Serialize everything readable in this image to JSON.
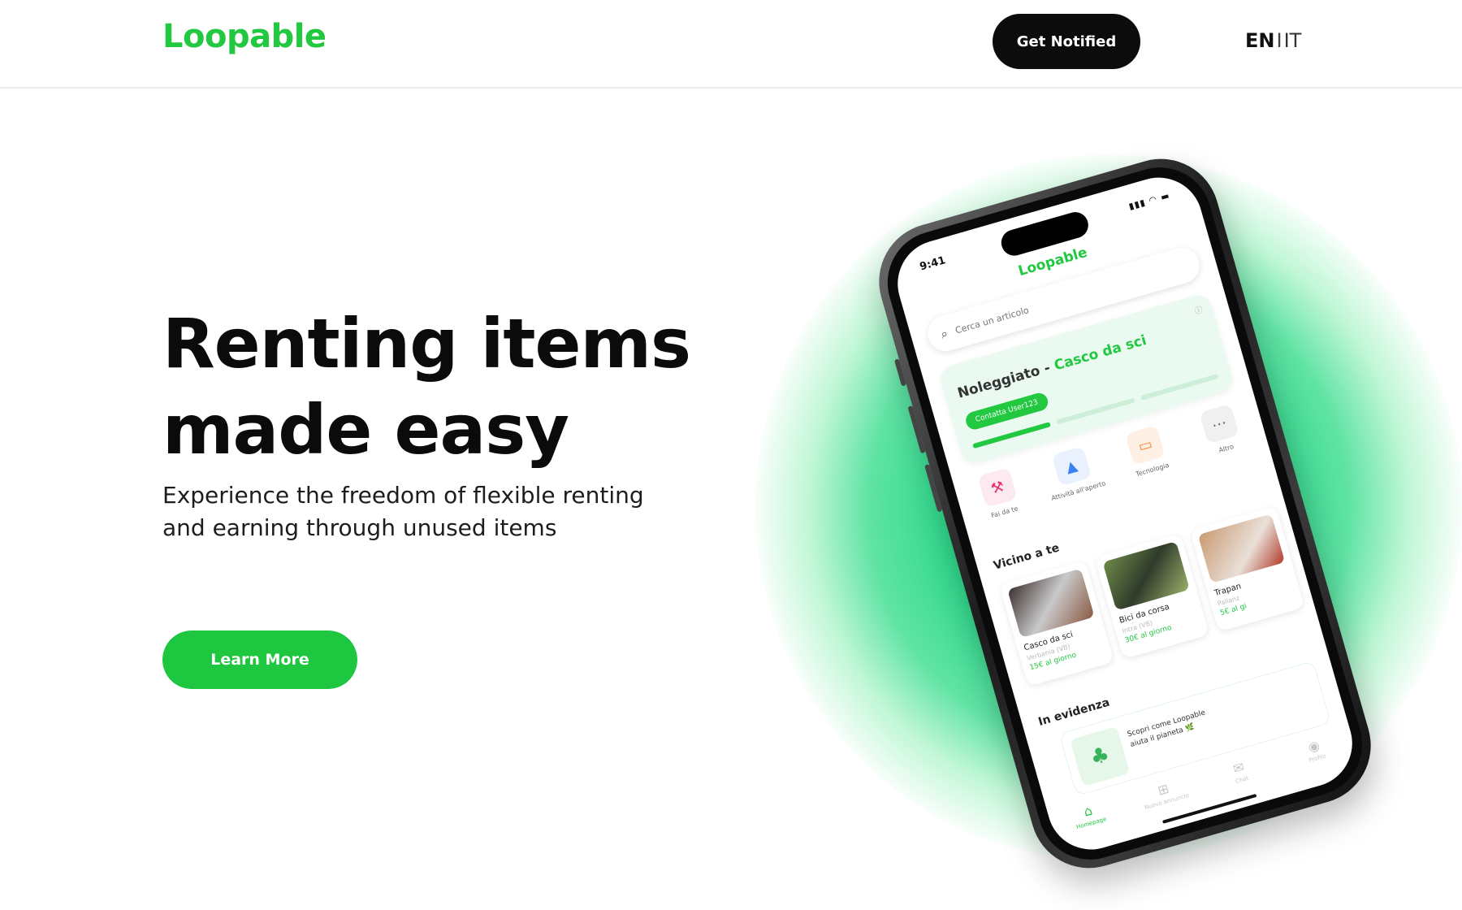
{
  "header": {
    "logo": "Loopable",
    "notify_button": "Get Notified",
    "lang_en": "EN",
    "lang_sep": "I",
    "lang_it": "IT"
  },
  "hero": {
    "title_line1": "Renting items",
    "title_line2": "made easy",
    "subtitle_line1": "Experience the freedom of flexible renting",
    "subtitle_line2": "and earning through unused items",
    "cta_button": "Learn More"
  },
  "phone": {
    "time": "9:41",
    "app_logo": "Loopable",
    "search_placeholder": "Cerca un articolo",
    "rent_card": {
      "status": "Noleggiato - ",
      "item": "Casco da sci",
      "contact_button": "Contatta User123"
    },
    "categories": [
      {
        "label": "Fai da te",
        "icon": "hammer-icon"
      },
      {
        "label": "Attività all'aperto",
        "icon": "tent-icon"
      },
      {
        "label": "Tecnologia",
        "icon": "laptop-icon"
      },
      {
        "label": "Altro",
        "icon": "more-icon"
      }
    ],
    "nearby_title": "Vicino a te",
    "nearby": [
      {
        "name": "Casco da sci",
        "location": "Verbania (VB)",
        "price": "15€ al giorno"
      },
      {
        "name": "Bici da corsa",
        "location": "Intra (VB)",
        "price": "30€ al giorno"
      },
      {
        "name": "Trapan",
        "location": "Pallanz",
        "price": "5€ al gi"
      }
    ],
    "featured_title": "In evidenza",
    "promo_text": "Scopri come Loopable aiuta il pianeta 🌿",
    "tabs": [
      {
        "label": "Homepage",
        "icon": "home-icon"
      },
      {
        "label": "Nuovo annuncio",
        "icon": "plus-icon"
      },
      {
        "label": "Chat",
        "icon": "chat-icon"
      },
      {
        "label": "Profilo",
        "icon": "profile-icon"
      }
    ]
  },
  "colors": {
    "brand_green": "#22c840",
    "dark_button": "#0c0c0c"
  }
}
